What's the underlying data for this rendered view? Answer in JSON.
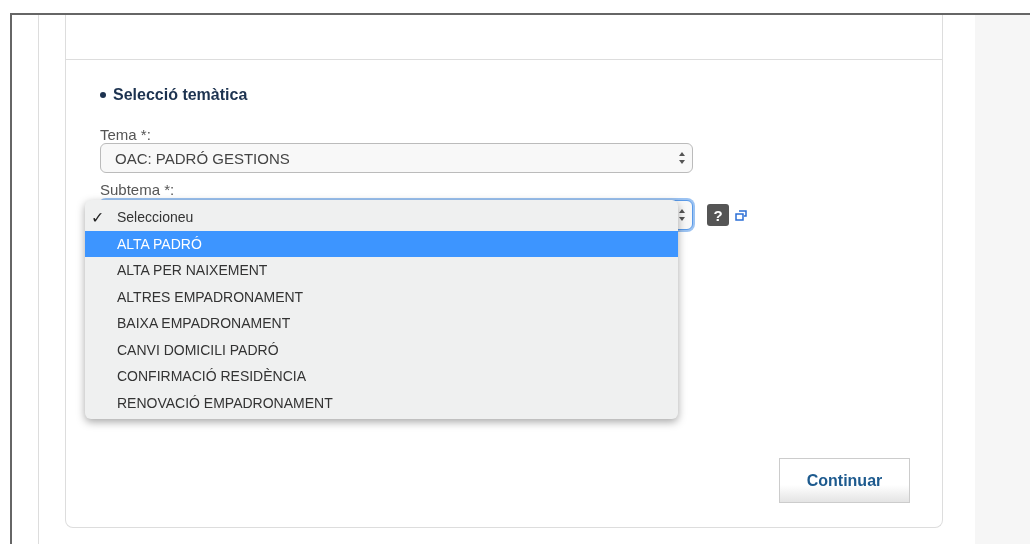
{
  "section": {
    "title": "Selecció temàtica"
  },
  "tema": {
    "label": "Tema *:",
    "value": "OAC: PADRÓ GESTIONS"
  },
  "subtema": {
    "label": "Subtema *:",
    "expanded": true,
    "options": [
      {
        "label": "Seleccioneu",
        "checked": true,
        "selected": false
      },
      {
        "label": "ALTA PADRÓ",
        "checked": false,
        "selected": true
      },
      {
        "label": "ALTA PER NAIXEMENT",
        "checked": false,
        "selected": false
      },
      {
        "label": "ALTRES EMPADRONAMENT",
        "checked": false,
        "selected": false
      },
      {
        "label": "BAIXA EMPADRONAMENT",
        "checked": false,
        "selected": false
      },
      {
        "label": "CANVI DOMICILI PADRÓ",
        "checked": false,
        "selected": false
      },
      {
        "label": "CONFIRMACIÓ RESIDÈNCIA",
        "checked": false,
        "selected": false
      },
      {
        "label": "RENOVACIÓ EMPADRONAMENT",
        "checked": false,
        "selected": false
      }
    ]
  },
  "check_mark": "✓",
  "help_icon_text": "?",
  "continue_button": "Continuar"
}
